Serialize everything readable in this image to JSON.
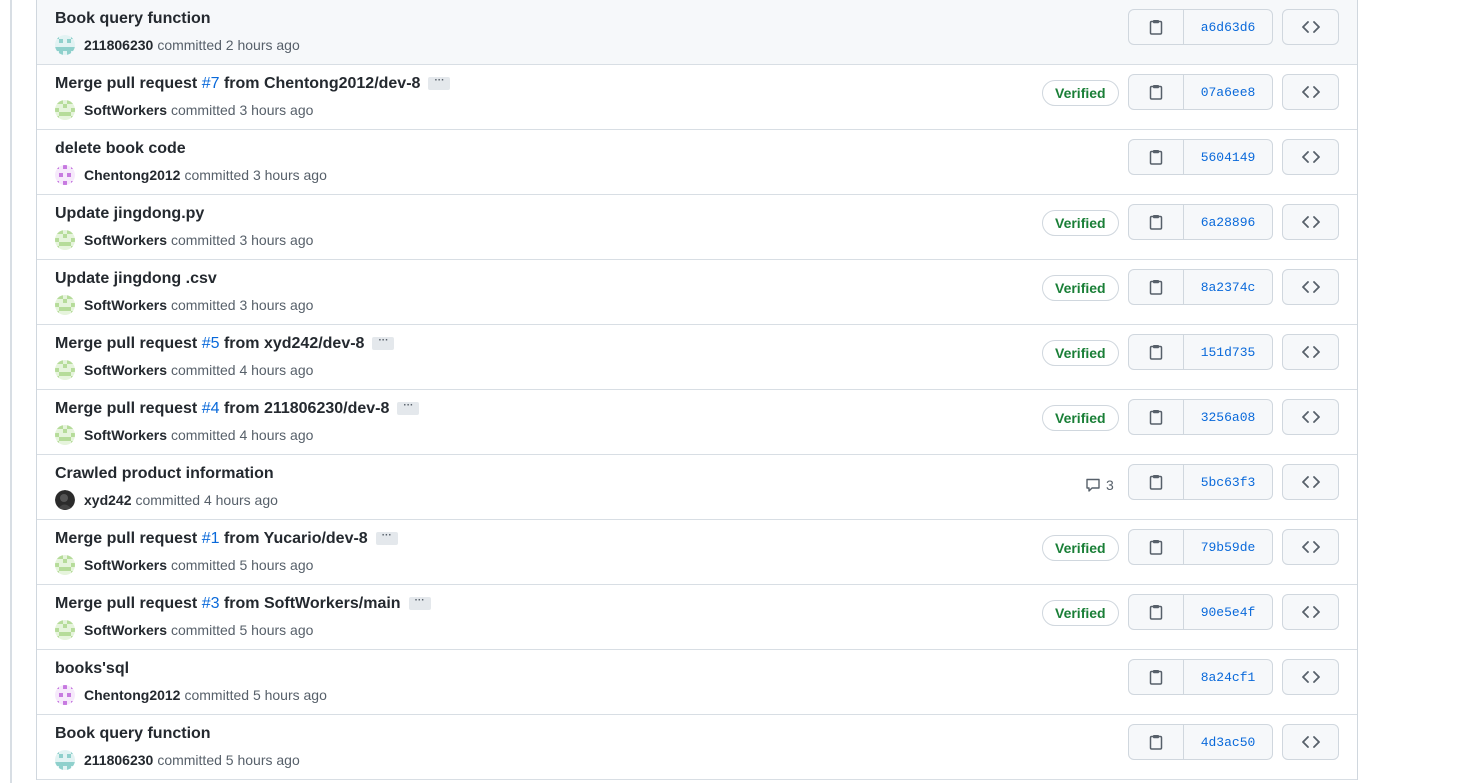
{
  "commit_list": {
    "verified_label": "Verified",
    "committed_label": "committed",
    "colors": {
      "link": "#0969da",
      "verified": "#1a7f37",
      "muted": "#57606a"
    },
    "commits": [
      {
        "title": "Book query function",
        "title_pre": "Book query function",
        "pr": "",
        "title_post": "",
        "has_ellipsis": false,
        "author": "211806230",
        "avatar": "teal",
        "time": "2 hours ago",
        "verified": false,
        "comments": "",
        "sha": "a6d63d6"
      },
      {
        "title": "Merge pull request #7 from Chentong2012/dev-8",
        "title_pre": "Merge pull request ",
        "pr": "#7",
        "title_post": " from Chentong2012/dev-8",
        "has_ellipsis": true,
        "author": "SoftWorkers",
        "avatar": "green",
        "time": "3 hours ago",
        "verified": true,
        "comments": "",
        "sha": "07a6ee8"
      },
      {
        "title": "delete book code",
        "title_pre": "delete book code",
        "pr": "",
        "title_post": "",
        "has_ellipsis": false,
        "author": "Chentong2012",
        "avatar": "purple",
        "time": "3 hours ago",
        "verified": false,
        "comments": "",
        "sha": "5604149"
      },
      {
        "title": "Update jingdong.py",
        "title_pre": "Update jingdong.py",
        "pr": "",
        "title_post": "",
        "has_ellipsis": false,
        "author": "SoftWorkers",
        "avatar": "green",
        "time": "3 hours ago",
        "verified": true,
        "comments": "",
        "sha": "6a28896"
      },
      {
        "title": "Update jingdong .csv",
        "title_pre": "Update jingdong .csv",
        "pr": "",
        "title_post": "",
        "has_ellipsis": false,
        "author": "SoftWorkers",
        "avatar": "green",
        "time": "3 hours ago",
        "verified": true,
        "comments": "",
        "sha": "8a2374c"
      },
      {
        "title": "Merge pull request #5 from xyd242/dev-8",
        "title_pre": "Merge pull request ",
        "pr": "#5",
        "title_post": " from xyd242/dev-8",
        "has_ellipsis": true,
        "author": "SoftWorkers",
        "avatar": "green",
        "time": "4 hours ago",
        "verified": true,
        "comments": "",
        "sha": "151d735"
      },
      {
        "title": "Merge pull request #4 from 211806230/dev-8",
        "title_pre": "Merge pull request ",
        "pr": "#4",
        "title_post": " from 211806230/dev-8",
        "has_ellipsis": true,
        "author": "SoftWorkers",
        "avatar": "green",
        "time": "4 hours ago",
        "verified": true,
        "comments": "",
        "sha": "3256a08"
      },
      {
        "title": "Crawled product information",
        "title_pre": "Crawled product information",
        "pr": "",
        "title_post": "",
        "has_ellipsis": false,
        "author": "xyd242",
        "avatar": "photo",
        "time": "4 hours ago",
        "verified": false,
        "comments": "3",
        "sha": "5bc63f3"
      },
      {
        "title": "Merge pull request #1 from Yucario/dev-8",
        "title_pre": "Merge pull request ",
        "pr": "#1",
        "title_post": " from Yucario/dev-8",
        "has_ellipsis": true,
        "author": "SoftWorkers",
        "avatar": "green",
        "time": "5 hours ago",
        "verified": true,
        "comments": "",
        "sha": "79b59de"
      },
      {
        "title": "Merge pull request #3 from SoftWorkers/main",
        "title_pre": "Merge pull request ",
        "pr": "#3",
        "title_post": " from SoftWorkers/main",
        "has_ellipsis": true,
        "author": "SoftWorkers",
        "avatar": "green",
        "time": "5 hours ago",
        "verified": true,
        "comments": "",
        "sha": "90e5e4f"
      },
      {
        "title": "books'sql",
        "title_pre": "books'sql",
        "pr": "",
        "title_post": "",
        "has_ellipsis": false,
        "author": "Chentong2012",
        "avatar": "purple",
        "time": "5 hours ago",
        "verified": false,
        "comments": "",
        "sha": "8a24cf1"
      },
      {
        "title": "Book query function",
        "title_pre": "Book query function",
        "pr": "",
        "title_post": "",
        "has_ellipsis": false,
        "author": "211806230",
        "avatar": "teal",
        "time": "5 hours ago",
        "verified": false,
        "comments": "",
        "sha": "4d3ac50"
      }
    ]
  }
}
